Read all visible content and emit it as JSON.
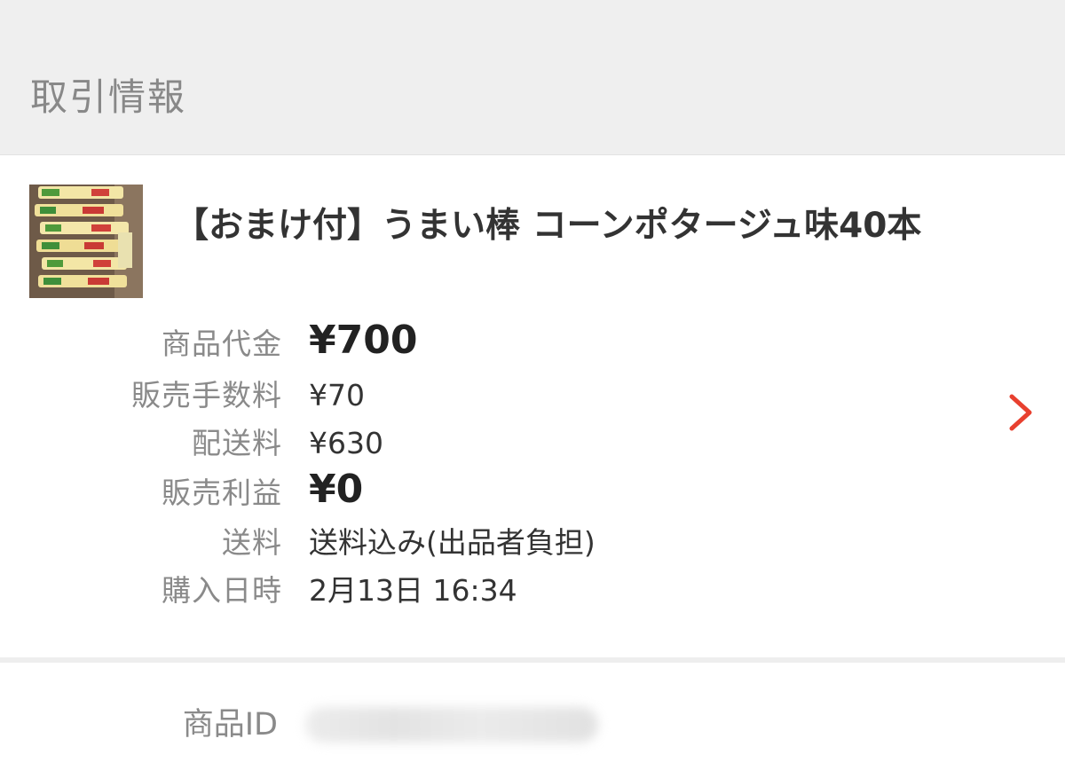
{
  "section": {
    "title": "取引情報"
  },
  "item": {
    "title": "【おまけ付】うまい棒 コーンポタージュ味40本",
    "thumbnail_icon": "product-thumbnail-umaibo"
  },
  "details": {
    "price": {
      "label": "商品代金",
      "value": "¥700"
    },
    "fee": {
      "label": "販売手数料",
      "value": "¥70"
    },
    "shipping_cost": {
      "label": "配送料",
      "value": "¥630"
    },
    "profit": {
      "label": "販売利益",
      "value": "¥0"
    },
    "shipping": {
      "label": "送料",
      "value": "送料込み(出品者負担)"
    },
    "purchased_at": {
      "label": "購入日時",
      "value": "2月13日 16:34"
    }
  },
  "product_id": {
    "label": "商品ID"
  },
  "colors": {
    "accent": "#e8402f",
    "header_bg": "#efefef",
    "label": "#8a8a8a",
    "text": "#333333"
  },
  "icons": {
    "chevron": "chevron-right-icon"
  }
}
